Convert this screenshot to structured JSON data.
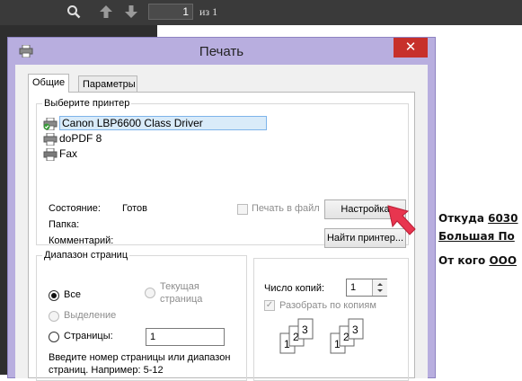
{
  "viewer": {
    "page_input_value": "1",
    "page_of": "из 1",
    "icons": [
      "search-icon",
      "arrow-up-icon",
      "arrow-down-icon"
    ]
  },
  "document": {
    "from_label": "Откуда",
    "from_value": "6030",
    "street_value": "Большая По",
    "who_label": "От кого",
    "who_value": "ООО"
  },
  "dialog": {
    "title": "Печать",
    "close_glyph": "✕",
    "tabs": [
      {
        "label": "Общие",
        "active": true
      },
      {
        "label": "Параметры",
        "active": false
      }
    ],
    "select_printer": {
      "legend": "Выберите принтер",
      "printers": [
        {
          "name": "Canon LBP6600 Class Driver",
          "selected": true
        },
        {
          "name": "doPDF 8",
          "selected": false
        },
        {
          "name": "Fax",
          "selected": false
        }
      ],
      "status_label": "Состояние:",
      "status_value": "Готов",
      "folder_label": "Папка:",
      "comment_label": "Комментарий:",
      "print_to_file_label": "Печать в файл",
      "settings_button": "Настройка",
      "find_printer_button": "Найти принтер..."
    },
    "page_range": {
      "legend": "Диапазон страниц",
      "all_label": "Все",
      "current_label_1": "Текущая",
      "current_label_2": "страница",
      "selection_label": "Выделение",
      "pages_label": "Страницы:",
      "pages_value": "1",
      "hint_line1": "Введите номер страницы или диапазон",
      "hint_line2": "страниц.  Например: 5-12"
    },
    "copies": {
      "label": "Число копий:",
      "value": "1",
      "collate_label": "Разобрать по копиям",
      "collate_icon": "collate-icon"
    }
  },
  "colors": {
    "dialog_frame": "#b8aedf",
    "close_button": "#c7302b",
    "viewer_toolbar": "#3a3a3a",
    "arrow": "#e8354f"
  }
}
